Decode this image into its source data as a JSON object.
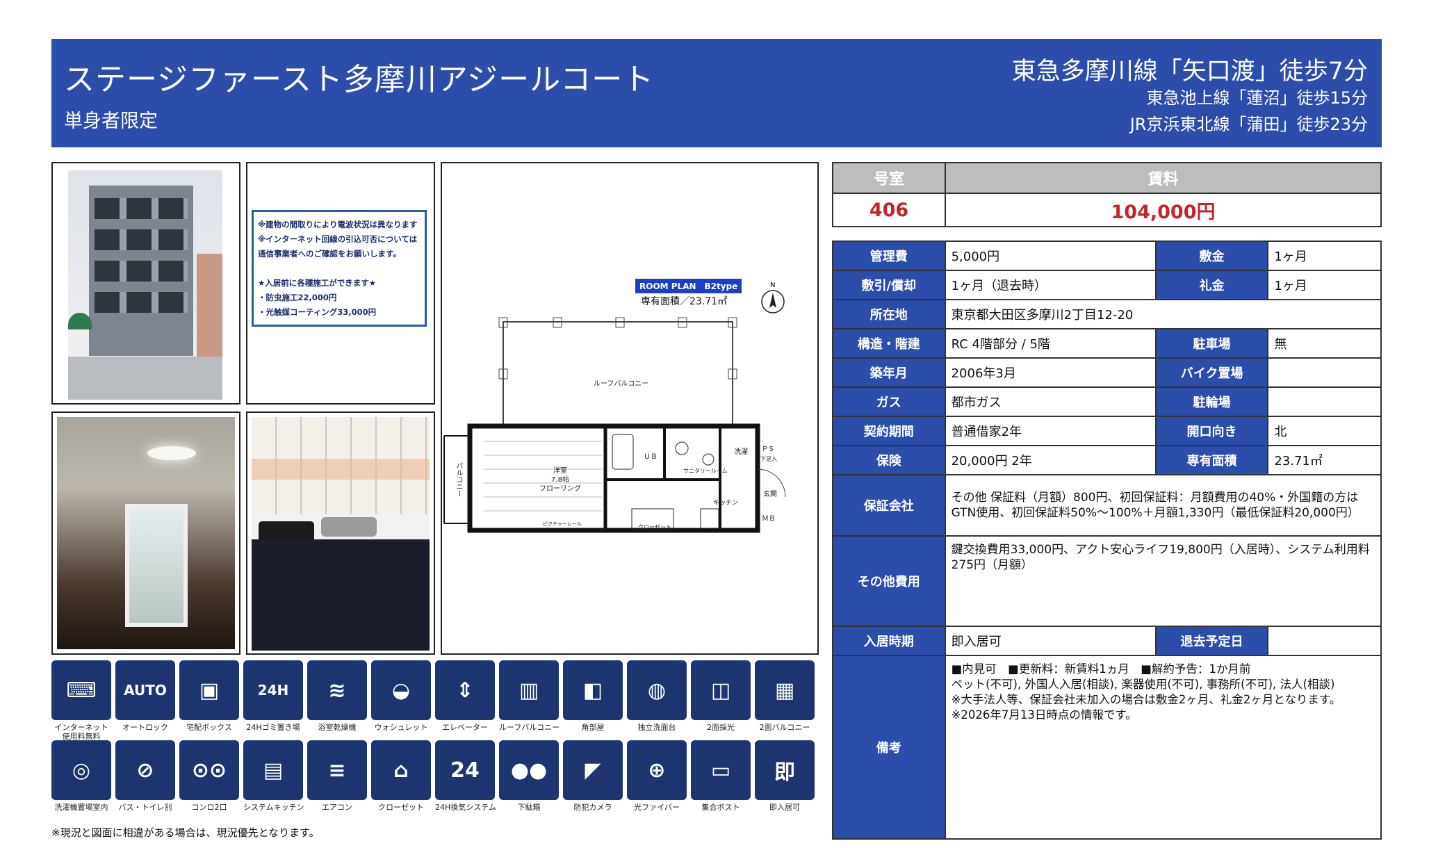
{
  "header": {
    "title": "ステージファースト多摩川アジールコート",
    "subtitle": "単身者限定",
    "station1": "東急多摩川線「矢口渡」徒歩7分",
    "station2": "東急池上線「蓮沼」徒歩15分",
    "station3": "JR京浜東北線「蒲田」徒歩23分"
  },
  "notice": [
    "※建物の間取りにより電波状況は異なります",
    "※インターネット回線の引込可否については",
    "通信事業者へのご確認をお願いします。",
    "",
    "★入居前に各種施工ができます★",
    "・防虫施工22,000円",
    "・光触媒コーティング33,000円"
  ],
  "plan": {
    "tag": "ROOM PLAN　B2type",
    "area": "専有面積／23.71㎡",
    "roof_balcony": "ルーフバルコニー",
    "balcony": "バルコニー",
    "room": "洋室\n7.8帖\nフローリング",
    "ub": "ＵＢ",
    "sanitary": "サニタリールーム",
    "wash": "洗濯",
    "ps": "ＰＳ",
    "shoes": "下足入",
    "kitchen": "キッチン",
    "entrance": "玄関",
    "closet": "クローゼット",
    "mb": "ＭＢ",
    "rail": "ピクチャーレール"
  },
  "top": {
    "room_h": "号室",
    "rent_h": "賃料",
    "room": "406",
    "rent": "104,000円"
  },
  "details": {
    "kanri_l": "管理費",
    "kanri_v": "5,000円",
    "shiki_l": "敷金",
    "shiki_v": "1ヶ月",
    "shikibiki_l": "敷引/償却",
    "shikibiki_v": "1ヶ月（退去時）",
    "rei_l": "礼金",
    "rei_v": "1ヶ月",
    "addr_l": "所在地",
    "addr_v": "東京都大田区多摩川2丁目12-20",
    "struct_l": "構造・階建",
    "struct_v": "RC 4階部分 / 5階",
    "park_l": "駐車場",
    "park_v": "無",
    "built_l": "築年月",
    "built_v": "2006年3月",
    "bike_l": "バイク置場",
    "bike_v": "",
    "gas_l": "ガス",
    "gas_v": "都市ガス",
    "cycle_l": "駐輪場",
    "cycle_v": "",
    "contract_l": "契約期間",
    "contract_v": "普通借家2年",
    "dir_l": "開口向き",
    "dir_v": "北",
    "ins_l": "保険",
    "ins_v": "20,000円 2年",
    "area_l": "専有面積",
    "area_v": "23.71㎡",
    "guar_l": "保証会社",
    "guar_v1": "その他 保証料（月額）800円、初回保証料：月額費用の40%・外国籍の方は",
    "guar_v2": "GTN使用、初回保証料50%～100%＋月額1,330円（最低保証料20,000円）",
    "other_l": "その他費用",
    "other_v1": "鍵交換費用33,000円、アクト安心ライフ19,800円（入居時）、システム利用料",
    "other_v2": "275円（月額）",
    "movein_l": "入居時期",
    "movein_v": "即入居可",
    "moveout_l": "退去予定日",
    "moveout_v": "",
    "note_l": "備考",
    "note_v1": "■内見可　■更新料：新賃料1ヵ月　■解約予告：1か月前",
    "note_v2": "ペット(不可), 外国人入居(相談), 楽器使用(不可), 事務所(不可), 法人(相談)",
    "note_v3": "※大手法人等、保証会社未加入の場合は敷金2ヶ月、礼金2ヶ月となります。",
    "note_v4": "※2026年7月13日時点の情報です。"
  },
  "icons": [
    {
      "name": "internet-free-icon",
      "glyph": "⌨",
      "caption": "インターネット\n使用料無料"
    },
    {
      "name": "autolock-icon",
      "glyph": "AUTO",
      "caption": "オートロック"
    },
    {
      "name": "delivery-box-icon",
      "glyph": "▣",
      "caption": "宅配ボックス"
    },
    {
      "name": "garbage-24h-icon",
      "glyph": "24H",
      "caption": "24Hゴミ置き場"
    },
    {
      "name": "bathroom-dryer-icon",
      "glyph": "≋",
      "caption": "浴室乾燥機"
    },
    {
      "name": "washlet-icon",
      "glyph": "◒",
      "caption": "ウォシュレット"
    },
    {
      "name": "elevator-icon",
      "glyph": "⇕",
      "caption": "エレベーター"
    },
    {
      "name": "roof-balcony-icon",
      "glyph": "▥",
      "caption": "ルーフバルコニー"
    },
    {
      "name": "corner-room-icon",
      "glyph": "◧",
      "caption": "角部屋"
    },
    {
      "name": "vanity-icon",
      "glyph": "◍",
      "caption": "独立洗面台"
    },
    {
      "name": "two-side-light-icon",
      "glyph": "◫",
      "caption": "2面採光"
    },
    {
      "name": "two-side-balcony-icon",
      "glyph": "▦",
      "caption": "2面バルコニー"
    },
    {
      "name": "washer-space-icon",
      "glyph": "◎",
      "caption": "洗濯機置場室内"
    },
    {
      "name": "bath-toilet-separate-icon",
      "glyph": "⊘",
      "caption": "バス・トイレ別"
    },
    {
      "name": "stove-2-icon",
      "glyph": "⊙⊙",
      "caption": "コンロ2口"
    },
    {
      "name": "system-kitchen-icon",
      "glyph": "▤",
      "caption": "システムキッチン"
    },
    {
      "name": "aircon-icon",
      "glyph": "≡",
      "caption": "エアコン"
    },
    {
      "name": "closet-icon",
      "glyph": "⌂",
      "caption": "クローゼット"
    },
    {
      "name": "ventilation-24h-icon",
      "glyph": "24",
      "caption": "24H換気システム"
    },
    {
      "name": "shoe-box-icon",
      "glyph": "●●",
      "caption": "下駄箱"
    },
    {
      "name": "security-camera-icon",
      "glyph": "◤",
      "caption": "防犯カメラ"
    },
    {
      "name": "fiber-icon",
      "glyph": "⊕",
      "caption": "光ファイバー"
    },
    {
      "name": "mailbox-icon",
      "glyph": "▭",
      "caption": "集合ポスト"
    },
    {
      "name": "immediate-icon",
      "glyph": "即",
      "caption": "即入居可"
    }
  ],
  "footer": "※現況と図面に相違がある場合は、現況優先となります。"
}
